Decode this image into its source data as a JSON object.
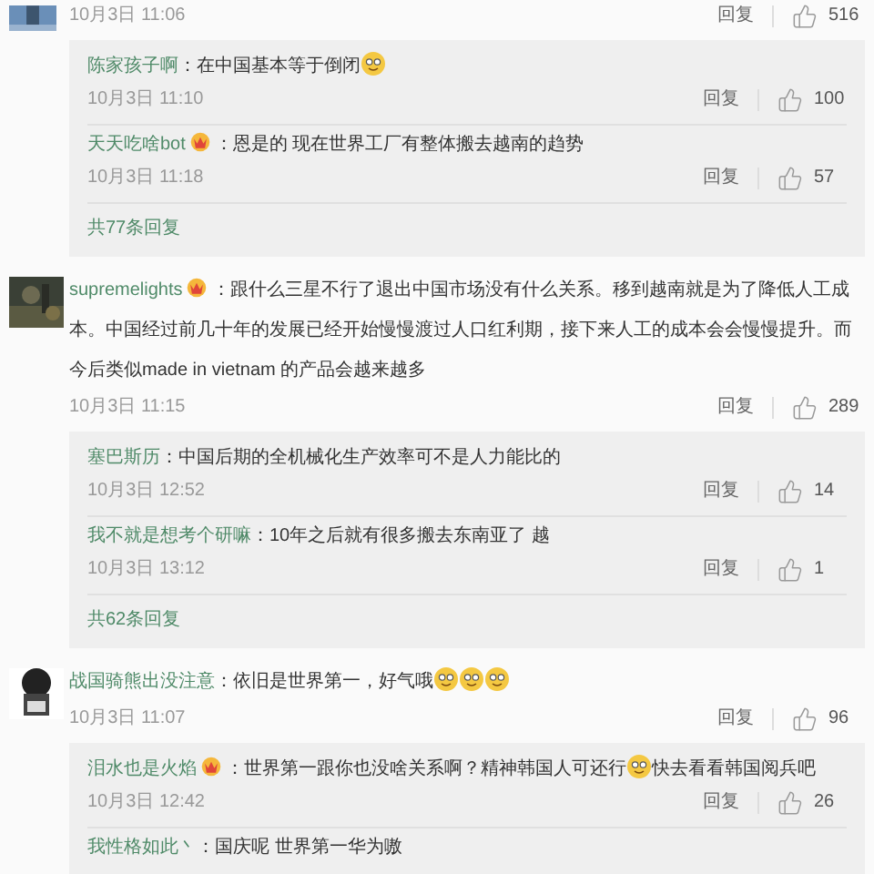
{
  "comments": [
    {
      "time": "10月3日 11:06",
      "reply_label": "回复",
      "likes": "516",
      "avatar": {
        "kind": "picture"
      },
      "replies": [
        {
          "user": "陈家孩子啊",
          "badge": false,
          "segments": [
            {
              "kind": "text",
              "text": "：在中国基本等于倒闭"
            },
            {
              "kind": "emoji"
            }
          ],
          "time": "10月3日 11:10",
          "reply_label": "回复",
          "likes": "100"
        },
        {
          "user": "天天吃啥bot",
          "badge": true,
          "segments": [
            {
              "kind": "text",
              "text": "：恩是的 现在世界工厂有整体搬去越南的趋势"
            }
          ],
          "time": "10月3日 11:18",
          "reply_label": "回复",
          "likes": "57"
        }
      ],
      "reply_total": "共77条回复"
    },
    {
      "user": "supremelights",
      "badge": true,
      "segments": [
        {
          "kind": "text",
          "text": "：跟什么三星不行了退出中国市场没有什么关系。移到越南就是为了降低人工成本。中国经过前几十年的发展已经开始慢慢渡过人口红利期，接下来人工的成本会会慢慢提升。而今后类似made in vietnam 的产品会越来越多"
        }
      ],
      "time": "10月3日 11:15",
      "reply_label": "回复",
      "likes": "289",
      "avatar": {
        "kind": "picture"
      },
      "replies": [
        {
          "user": "塞巴斯历",
          "badge": false,
          "segments": [
            {
              "kind": "text",
              "text": "：中国后期的全机械化生产效率可不是人力能比的"
            }
          ],
          "time": "10月3日 12:52",
          "reply_label": "回复",
          "likes": "14"
        },
        {
          "user": "我不就是想考个研嘛",
          "badge": false,
          "segments": [
            {
              "kind": "text",
              "text": "：10年之后就有很多搬去东南亚了 越"
            }
          ],
          "time": "10月3日 13:12",
          "reply_label": "回复",
          "likes": "1"
        }
      ],
      "reply_total": "共62条回复"
    },
    {
      "user": "战国骑熊出没注意",
      "badge": false,
      "segments": [
        {
          "kind": "text",
          "text": "：依旧是世界第一，好气哦"
        },
        {
          "kind": "emoji"
        },
        {
          "kind": "emoji"
        },
        {
          "kind": "emoji"
        }
      ],
      "time": "10月3日 11:07",
      "reply_label": "回复",
      "likes": "96",
      "avatar": {
        "kind": "picture"
      },
      "replies": [
        {
          "user": "泪水也是火焰",
          "badge": true,
          "segments": [
            {
              "kind": "text",
              "text": "：世界第一跟你也没啥关系啊？精神韩国人可还行"
            },
            {
              "kind": "emoji"
            },
            {
              "kind": "text",
              "text": "快去看看韩国阅兵吧"
            }
          ],
          "time": "10月3日 12:42",
          "reply_label": "回复",
          "likes": "26"
        },
        {
          "user": "我性格如此丶",
          "badge": false,
          "segments": [
            {
              "kind": "text",
              "text": "：国庆呢 世界第一华为嗷"
            }
          ]
        }
      ]
    }
  ]
}
